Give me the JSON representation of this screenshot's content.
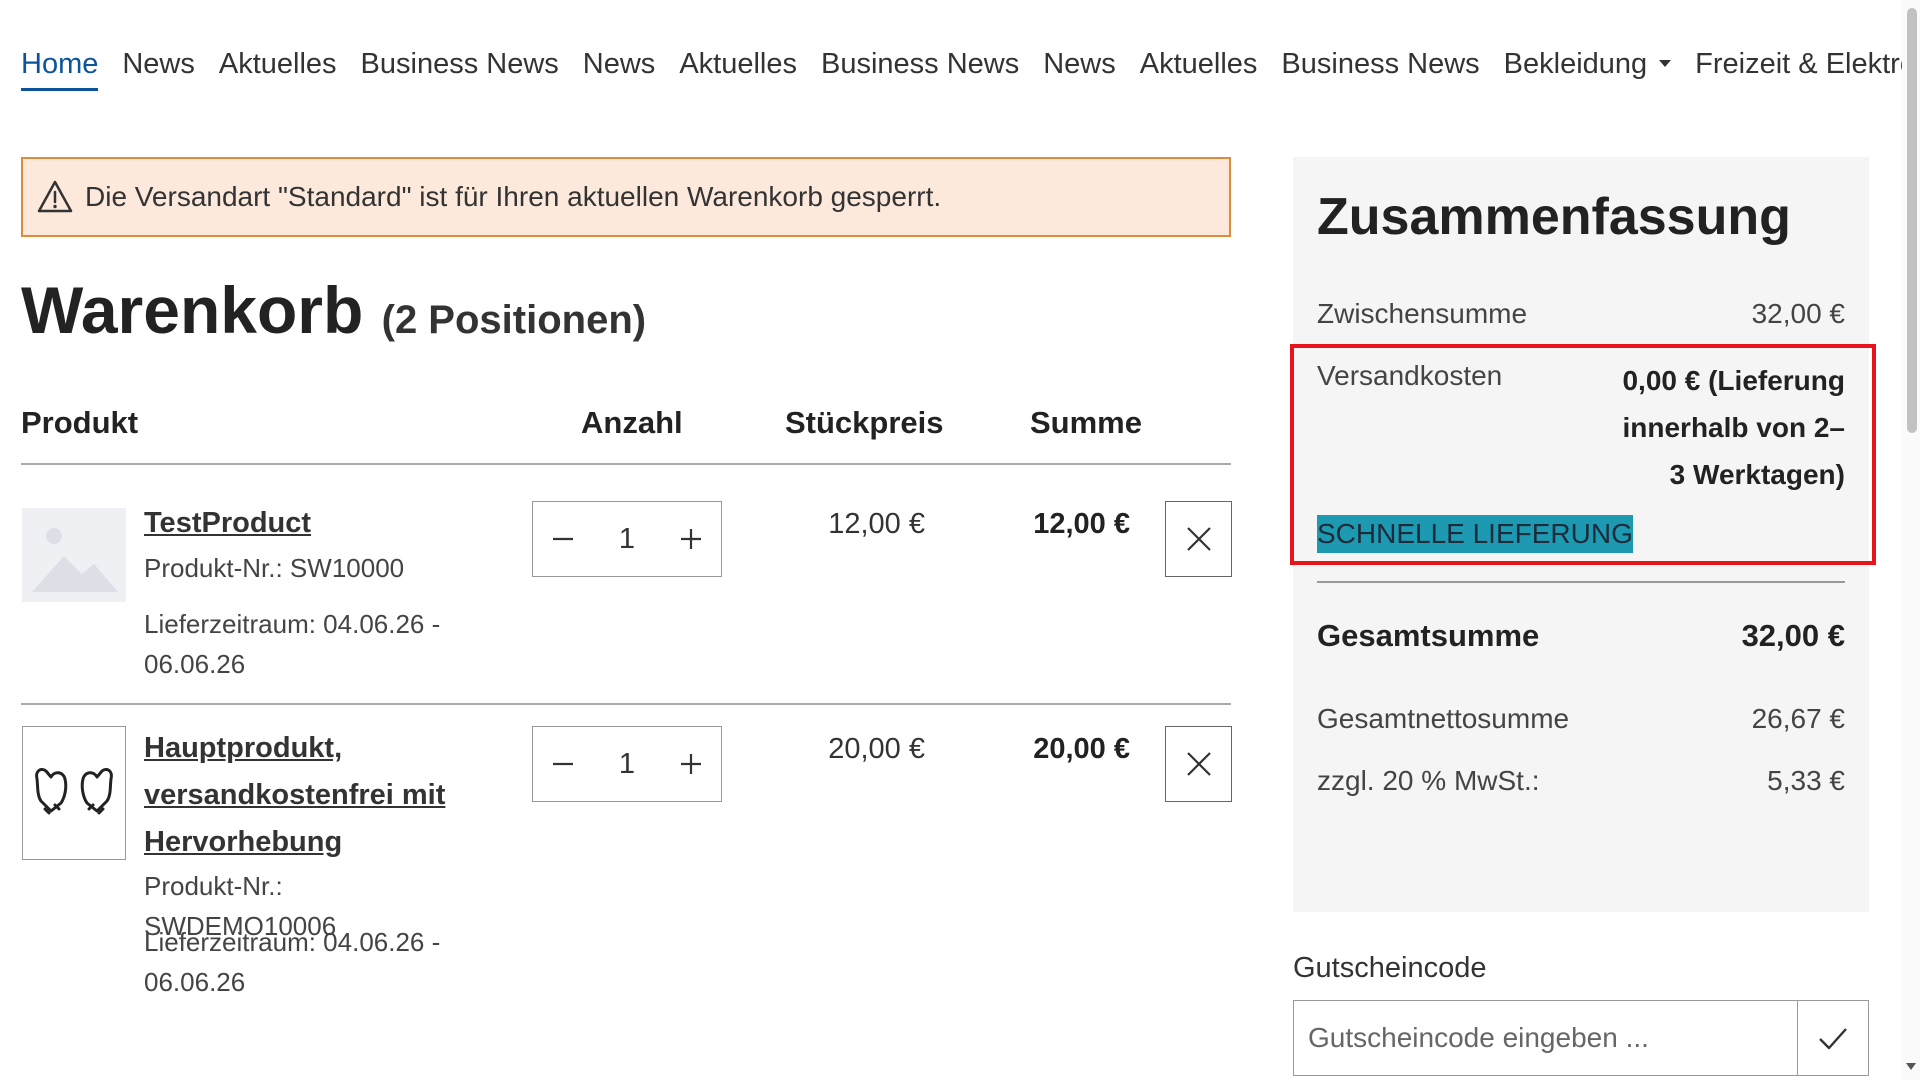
{
  "nav": {
    "items": [
      {
        "label": "Home",
        "active": true
      },
      {
        "label": "News"
      },
      {
        "label": "Aktuelles"
      },
      {
        "label": "Business News"
      },
      {
        "label": "News"
      },
      {
        "label": "Aktuelles"
      },
      {
        "label": "Business News"
      },
      {
        "label": "News"
      },
      {
        "label": "Aktuelles"
      },
      {
        "label": "Business News"
      },
      {
        "label": "Bekleidung",
        "has_dropdown": true
      },
      {
        "label": "Freizeit & Elektro"
      }
    ]
  },
  "alert": {
    "icon": "warning-icon",
    "text": "Die Versandart \"Standard\" ist für Ihren aktuellen Warenkorb gesperrt.",
    "color": "#e08a3c"
  },
  "cart": {
    "title": "Warenkorb",
    "count_label": "(2 Positionen)",
    "columns": {
      "product": "Produkt",
      "quantity": "Anzahl",
      "unit_price": "Stückpreis",
      "total": "Summe"
    },
    "items": [
      {
        "name": "TestProduct",
        "sku": "Produkt-Nr.: SW10000",
        "delivery": "Lieferzeitraum: 04.06.26 - 06.06.26",
        "quantity": "1",
        "unit_price": "12,00 €",
        "total": "12,00 €",
        "image": "placeholder-image-icon"
      },
      {
        "name": "Hauptprodukt, versandkostenfrei mit Hervorhebung",
        "sku": "Produkt-Nr.: SWDEMO10006",
        "delivery": "Lieferzeitraum: 04.06.26 - 06.06.26",
        "quantity": "1",
        "unit_price": "20,00 €",
        "total": "20,00 €",
        "image": "gloves-icon"
      }
    ]
  },
  "summary": {
    "title": "Zusammenfassung",
    "subtotal_label": "Zwischensumme",
    "subtotal_value": "32,00 €",
    "shipping_label": "Versandkosten",
    "shipping_value": "0,00 € (Lieferung innerhalb von 2–3 Werktagen)",
    "fast_delivery_badge": "SCHNELLE LIEFERUNG",
    "total_label": "Gesamtsumme",
    "total_value": "32,00 €",
    "net_label": "Gesamtnettosumme",
    "net_value": "26,67 €",
    "tax_label": "zzgl. 20 % MwSt.:",
    "tax_value": "5,33 €",
    "highlight_color": "#e8141c",
    "badge_color": "#1d9ab2"
  },
  "voucher": {
    "label": "Gutscheincode",
    "placeholder": "Gutscheincode eingeben ...",
    "submit_icon": "checkmark-icon"
  }
}
